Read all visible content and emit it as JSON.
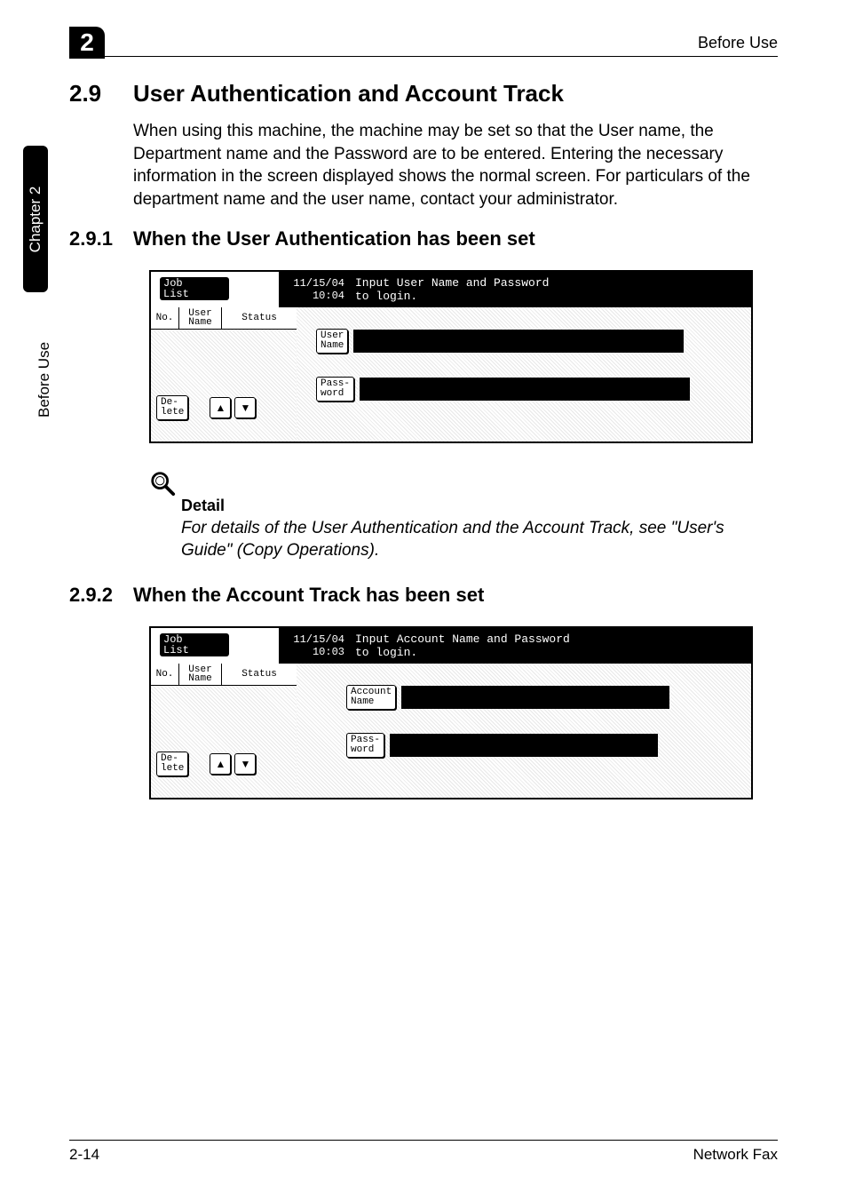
{
  "header": {
    "chapter_number": "2",
    "running_head": "Before Use"
  },
  "side": {
    "tab_label": "Chapter 2",
    "section_label": "Before Use"
  },
  "section": {
    "number": "2.9",
    "title": "User Authentication and Account Track",
    "intro": "When using this machine, the machine may be set so that the User name, the Department name and the Password are to be entered. Entering the necessary information in the screen displayed shows the normal screen. For particulars of the department name and the user name, contact your administrator."
  },
  "subsection1": {
    "number": "2.9.1",
    "title": "When the User Authentication has been set"
  },
  "panel1": {
    "job_tab": "Job\nList",
    "date": "11/15/04",
    "time": "10:04",
    "prompt_line1": "Input User Name and Password",
    "prompt_line2": "to login.",
    "col_no": "No.",
    "col_user": "User\nName",
    "col_status": "Status",
    "delete_btn": "De-\nlete",
    "field1": "User\nName",
    "field2": "Pass-\nword"
  },
  "detail": {
    "label": "Detail",
    "text": "For details of the User Authentication and the Account Track, see \"User's Guide\" (Copy Operations)."
  },
  "subsection2": {
    "number": "2.9.2",
    "title": "When the Account Track has been set"
  },
  "panel2": {
    "job_tab": "Job\nList",
    "date": "11/15/04",
    "time": "10:03",
    "prompt_line1": "Input Account Name and Password",
    "prompt_line2": "to login.",
    "col_no": "No.",
    "col_user": "User\nName",
    "col_status": "Status",
    "delete_btn": "De-\nlete",
    "field1": "Account\nName",
    "field2": "Pass-\nword"
  },
  "footer": {
    "page": "2-14",
    "title": "Network Fax"
  }
}
